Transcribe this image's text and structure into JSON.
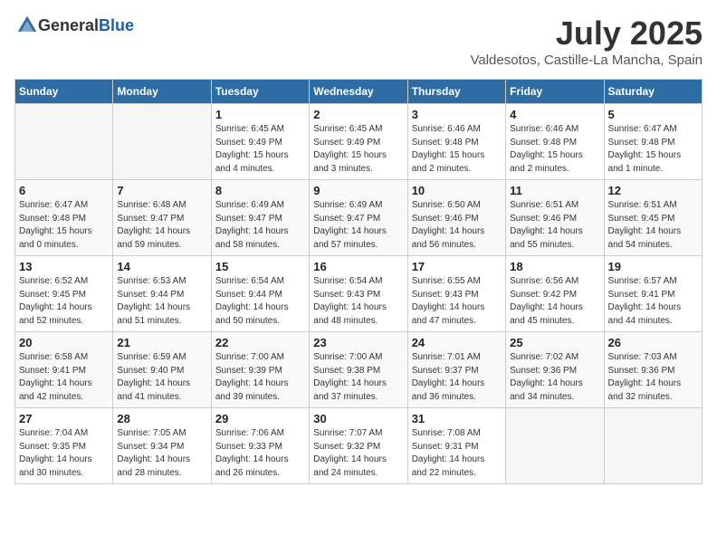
{
  "header": {
    "logo_general": "General",
    "logo_blue": "Blue",
    "month_year": "July 2025",
    "location": "Valdesotos, Castille-La Mancha, Spain"
  },
  "calendar": {
    "days_of_week": [
      "Sunday",
      "Monday",
      "Tuesday",
      "Wednesday",
      "Thursday",
      "Friday",
      "Saturday"
    ],
    "weeks": [
      [
        {
          "day": "",
          "detail": ""
        },
        {
          "day": "",
          "detail": ""
        },
        {
          "day": "1",
          "detail": "Sunrise: 6:45 AM\nSunset: 9:49 PM\nDaylight: 15 hours\nand 4 minutes."
        },
        {
          "day": "2",
          "detail": "Sunrise: 6:45 AM\nSunset: 9:49 PM\nDaylight: 15 hours\nand 3 minutes."
        },
        {
          "day": "3",
          "detail": "Sunrise: 6:46 AM\nSunset: 9:48 PM\nDaylight: 15 hours\nand 2 minutes."
        },
        {
          "day": "4",
          "detail": "Sunrise: 6:46 AM\nSunset: 9:48 PM\nDaylight: 15 hours\nand 2 minutes."
        },
        {
          "day": "5",
          "detail": "Sunrise: 6:47 AM\nSunset: 9:48 PM\nDaylight: 15 hours\nand 1 minute."
        }
      ],
      [
        {
          "day": "6",
          "detail": "Sunrise: 6:47 AM\nSunset: 9:48 PM\nDaylight: 15 hours\nand 0 minutes."
        },
        {
          "day": "7",
          "detail": "Sunrise: 6:48 AM\nSunset: 9:47 PM\nDaylight: 14 hours\nand 59 minutes."
        },
        {
          "day": "8",
          "detail": "Sunrise: 6:49 AM\nSunset: 9:47 PM\nDaylight: 14 hours\nand 58 minutes."
        },
        {
          "day": "9",
          "detail": "Sunrise: 6:49 AM\nSunset: 9:47 PM\nDaylight: 14 hours\nand 57 minutes."
        },
        {
          "day": "10",
          "detail": "Sunrise: 6:50 AM\nSunset: 9:46 PM\nDaylight: 14 hours\nand 56 minutes."
        },
        {
          "day": "11",
          "detail": "Sunrise: 6:51 AM\nSunset: 9:46 PM\nDaylight: 14 hours\nand 55 minutes."
        },
        {
          "day": "12",
          "detail": "Sunrise: 6:51 AM\nSunset: 9:45 PM\nDaylight: 14 hours\nand 54 minutes."
        }
      ],
      [
        {
          "day": "13",
          "detail": "Sunrise: 6:52 AM\nSunset: 9:45 PM\nDaylight: 14 hours\nand 52 minutes."
        },
        {
          "day": "14",
          "detail": "Sunrise: 6:53 AM\nSunset: 9:44 PM\nDaylight: 14 hours\nand 51 minutes."
        },
        {
          "day": "15",
          "detail": "Sunrise: 6:54 AM\nSunset: 9:44 PM\nDaylight: 14 hours\nand 50 minutes."
        },
        {
          "day": "16",
          "detail": "Sunrise: 6:54 AM\nSunset: 9:43 PM\nDaylight: 14 hours\nand 48 minutes."
        },
        {
          "day": "17",
          "detail": "Sunrise: 6:55 AM\nSunset: 9:43 PM\nDaylight: 14 hours\nand 47 minutes."
        },
        {
          "day": "18",
          "detail": "Sunrise: 6:56 AM\nSunset: 9:42 PM\nDaylight: 14 hours\nand 45 minutes."
        },
        {
          "day": "19",
          "detail": "Sunrise: 6:57 AM\nSunset: 9:41 PM\nDaylight: 14 hours\nand 44 minutes."
        }
      ],
      [
        {
          "day": "20",
          "detail": "Sunrise: 6:58 AM\nSunset: 9:41 PM\nDaylight: 14 hours\nand 42 minutes."
        },
        {
          "day": "21",
          "detail": "Sunrise: 6:59 AM\nSunset: 9:40 PM\nDaylight: 14 hours\nand 41 minutes."
        },
        {
          "day": "22",
          "detail": "Sunrise: 7:00 AM\nSunset: 9:39 PM\nDaylight: 14 hours\nand 39 minutes."
        },
        {
          "day": "23",
          "detail": "Sunrise: 7:00 AM\nSunset: 9:38 PM\nDaylight: 14 hours\nand 37 minutes."
        },
        {
          "day": "24",
          "detail": "Sunrise: 7:01 AM\nSunset: 9:37 PM\nDaylight: 14 hours\nand 36 minutes."
        },
        {
          "day": "25",
          "detail": "Sunrise: 7:02 AM\nSunset: 9:36 PM\nDaylight: 14 hours\nand 34 minutes."
        },
        {
          "day": "26",
          "detail": "Sunrise: 7:03 AM\nSunset: 9:36 PM\nDaylight: 14 hours\nand 32 minutes."
        }
      ],
      [
        {
          "day": "27",
          "detail": "Sunrise: 7:04 AM\nSunset: 9:35 PM\nDaylight: 14 hours\nand 30 minutes."
        },
        {
          "day": "28",
          "detail": "Sunrise: 7:05 AM\nSunset: 9:34 PM\nDaylight: 14 hours\nand 28 minutes."
        },
        {
          "day": "29",
          "detail": "Sunrise: 7:06 AM\nSunset: 9:33 PM\nDaylight: 14 hours\nand 26 minutes."
        },
        {
          "day": "30",
          "detail": "Sunrise: 7:07 AM\nSunset: 9:32 PM\nDaylight: 14 hours\nand 24 minutes."
        },
        {
          "day": "31",
          "detail": "Sunrise: 7:08 AM\nSunset: 9:31 PM\nDaylight: 14 hours\nand 22 minutes."
        },
        {
          "day": "",
          "detail": ""
        },
        {
          "day": "",
          "detail": ""
        }
      ]
    ]
  }
}
